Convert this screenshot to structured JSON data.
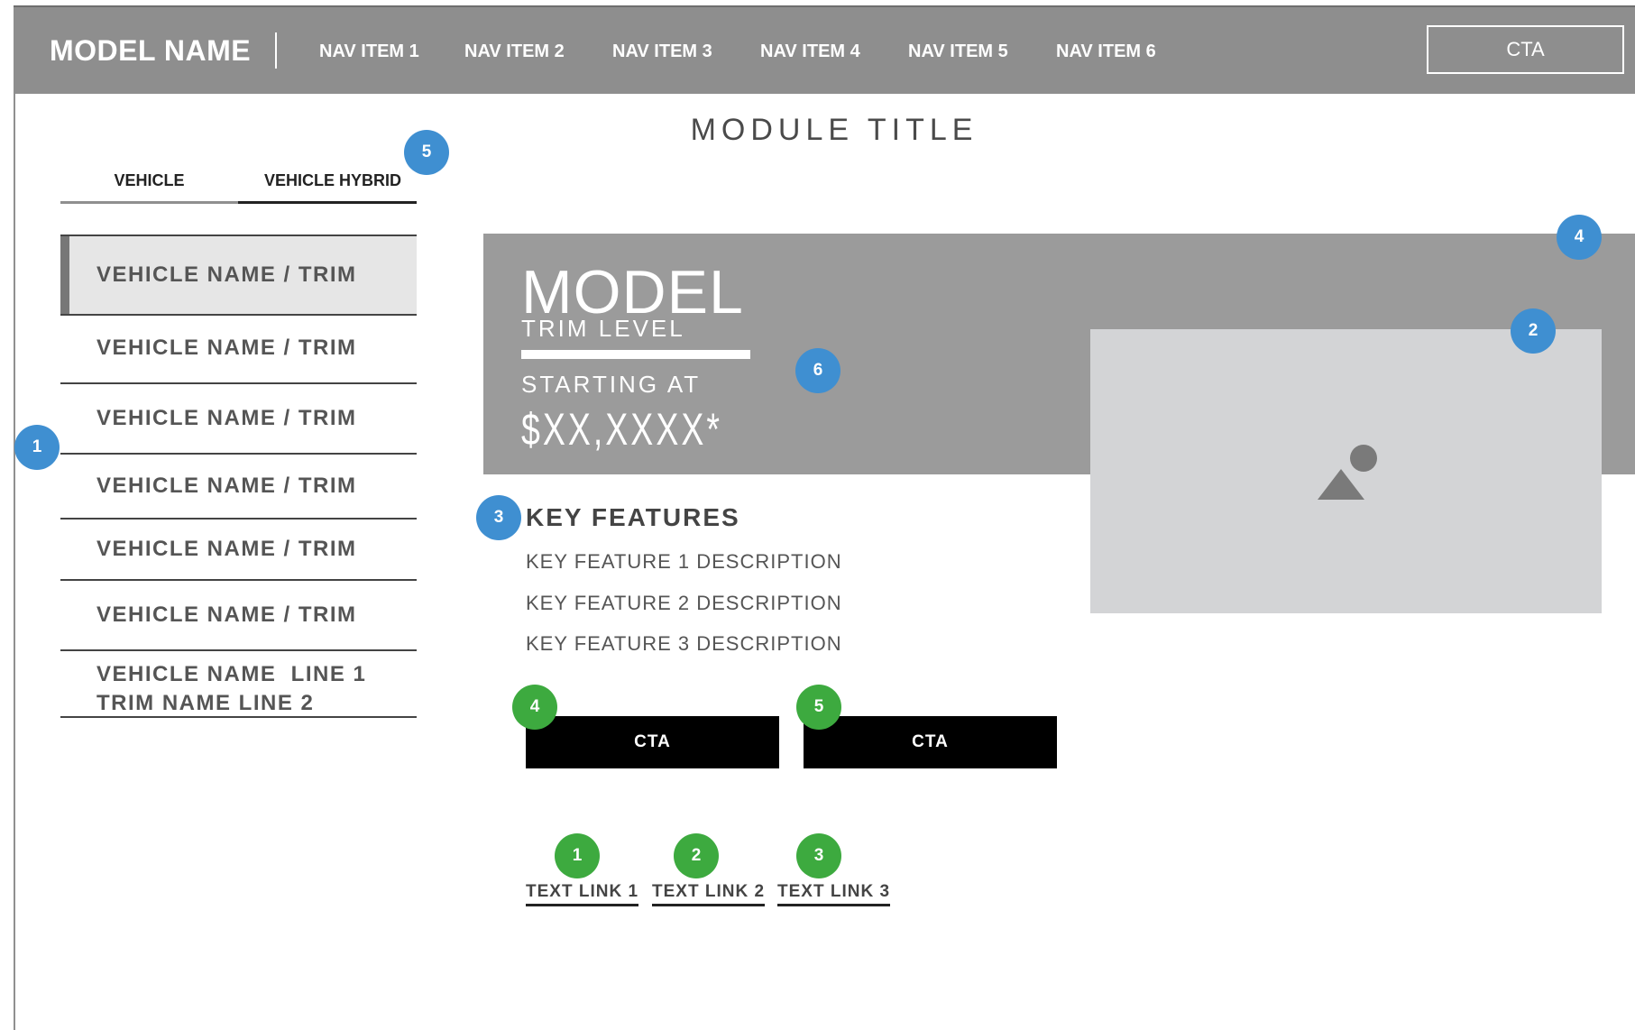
{
  "header": {
    "brand": "MODEL NAME",
    "nav": [
      "NAV ITEM 1",
      "NAV ITEM 2",
      "NAV ITEM 3",
      "NAV ITEM 4",
      "NAV ITEM 5",
      "NAV ITEM 6"
    ],
    "cta": "CTA"
  },
  "module_title": "MODULE TITLE",
  "tabs": [
    "VEHICLE",
    "VEHICLE HYBRID"
  ],
  "vehicles": [
    "VEHICLE NAME / TRIM",
    "VEHICLE NAME / TRIM",
    "VEHICLE NAME / TRIM",
    "VEHICLE NAME / TRIM",
    "VEHICLE NAME / TRIM",
    "VEHICLE NAME / TRIM"
  ],
  "vehicle_multiline": {
    "line1": "VEHICLE NAME  LINE 1",
    "line2": "TRIM NAME LINE 2"
  },
  "hero": {
    "model": "MODEL",
    "trim": "TRIM LEVEL",
    "starting_at": "STARTING AT",
    "price": "$XX,XXXX*"
  },
  "key_features": {
    "title": "KEY FEATURES",
    "items": [
      "KEY FEATURE 1 DESCRIPTION",
      "KEY FEATURE 2 DESCRIPTION",
      "KEY FEATURE 3 DESCRIPTION"
    ]
  },
  "ctas": [
    "CTA",
    "CTA"
  ],
  "text_links": [
    "TEXT LINK 1",
    "TEXT LINK 2",
    "TEXT LINK 3"
  ],
  "badges": {
    "blue": [
      "1",
      "2",
      "3",
      "4",
      "5",
      "6"
    ],
    "green": [
      "1",
      "2",
      "3",
      "4",
      "5"
    ]
  },
  "colors": {
    "nav_bg": "#8e8e8e",
    "hero_bg": "#9b9b9b",
    "badge_blue": "#3f8fd1",
    "badge_green": "#3daa3f"
  },
  "icons": {
    "image_placeholder": "image-icon"
  }
}
